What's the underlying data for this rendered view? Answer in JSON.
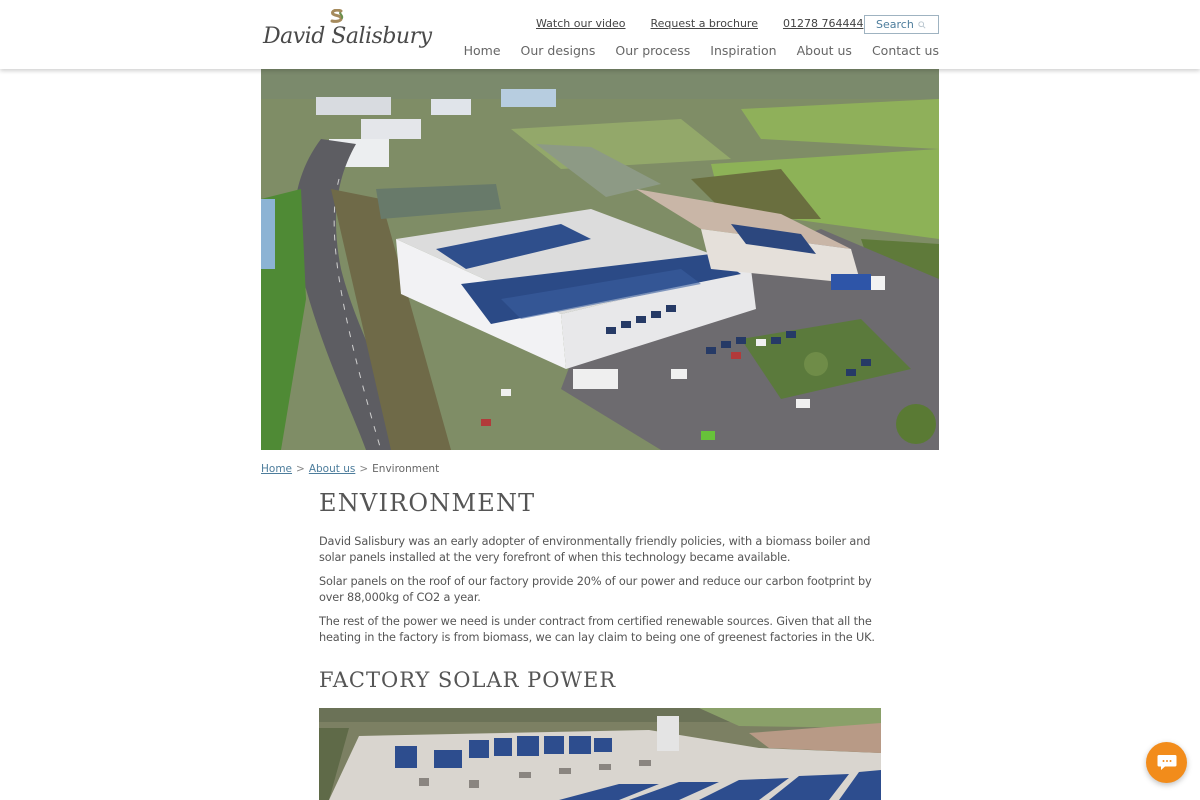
{
  "brand": {
    "logo_text": "David Salisbury"
  },
  "header": {
    "utility_links": [
      {
        "label": "Watch our video"
      },
      {
        "label": "Request a brochure"
      },
      {
        "label": "01278 764444"
      }
    ],
    "search": {
      "placeholder": "Search",
      "icon": "search-icon"
    },
    "nav": [
      {
        "label": "Home"
      },
      {
        "label": "Our designs"
      },
      {
        "label": "Our process"
      },
      {
        "label": "Inspiration"
      },
      {
        "label": "About us"
      },
      {
        "label": "Contact us"
      }
    ]
  },
  "hero": {
    "alt": "Aerial view of the David Salisbury factory with solar panels on the roof"
  },
  "breadcrumb": {
    "items": [
      {
        "label": "Home",
        "link": true
      },
      {
        "label": "About us",
        "link": true
      },
      {
        "label": "Environment",
        "link": false
      }
    ],
    "separator": ">"
  },
  "content": {
    "title": "ENVIRONMENT",
    "paragraphs": [
      "David Salisbury was an early adopter of environmentally friendly policies, with a biomass boiler and solar panels installed at the very forefront of when this technology became available.",
      "Solar panels on the roof of our factory provide 20% of our power and reduce our carbon footprint by over 88,000kg of CO2 a year.",
      "The rest of the power we need is under contract from certified renewable sources. Given that all the heating in the factory is from biomass, we can lay claim to being one of greenest factories in the UK."
    ],
    "section_heading": "FACTORY SOLAR POWER",
    "section_photo_alt": "Factory roof covered in solar panels"
  },
  "chat": {
    "icon": "chat-icon",
    "color": "#f28c1b"
  },
  "colors": {
    "link": "#4d7d9c",
    "text": "#555555",
    "chat_accent": "#f28c1b"
  }
}
